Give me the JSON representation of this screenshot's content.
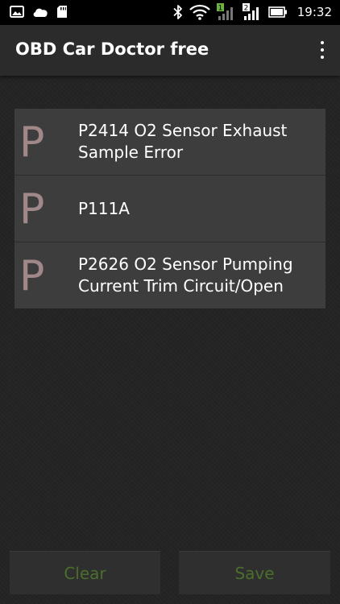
{
  "status_bar": {
    "time": "19:32",
    "sim1_label": "1",
    "sim2_label": "2",
    "left_icons": [
      "image-icon",
      "cloud-icon",
      "sd-card-icon"
    ],
    "right_icons": [
      "bluetooth-icon",
      "wifi-icon",
      "signal-sim1-icon",
      "signal-sim2-icon",
      "battery-icon"
    ]
  },
  "appbar": {
    "title": "OBD Car Doctor free",
    "menu_icon": "overflow-menu-icon"
  },
  "codes": [
    {
      "letter": "P",
      "text": "P2414 O2 Sensor Exhaust Sample Error"
    },
    {
      "letter": "P",
      "text": "P111A"
    },
    {
      "letter": "P",
      "text": "P2626 O2 Sensor Pumping Current Trim Circuit/Open"
    }
  ],
  "buttons": {
    "clear_label": "Clear",
    "save_label": "Save"
  },
  "colors": {
    "button_text": "#4a6f2a",
    "letter": "#a08888",
    "row_bg": "#3d3d3d",
    "sim_green": "#6db33f"
  }
}
